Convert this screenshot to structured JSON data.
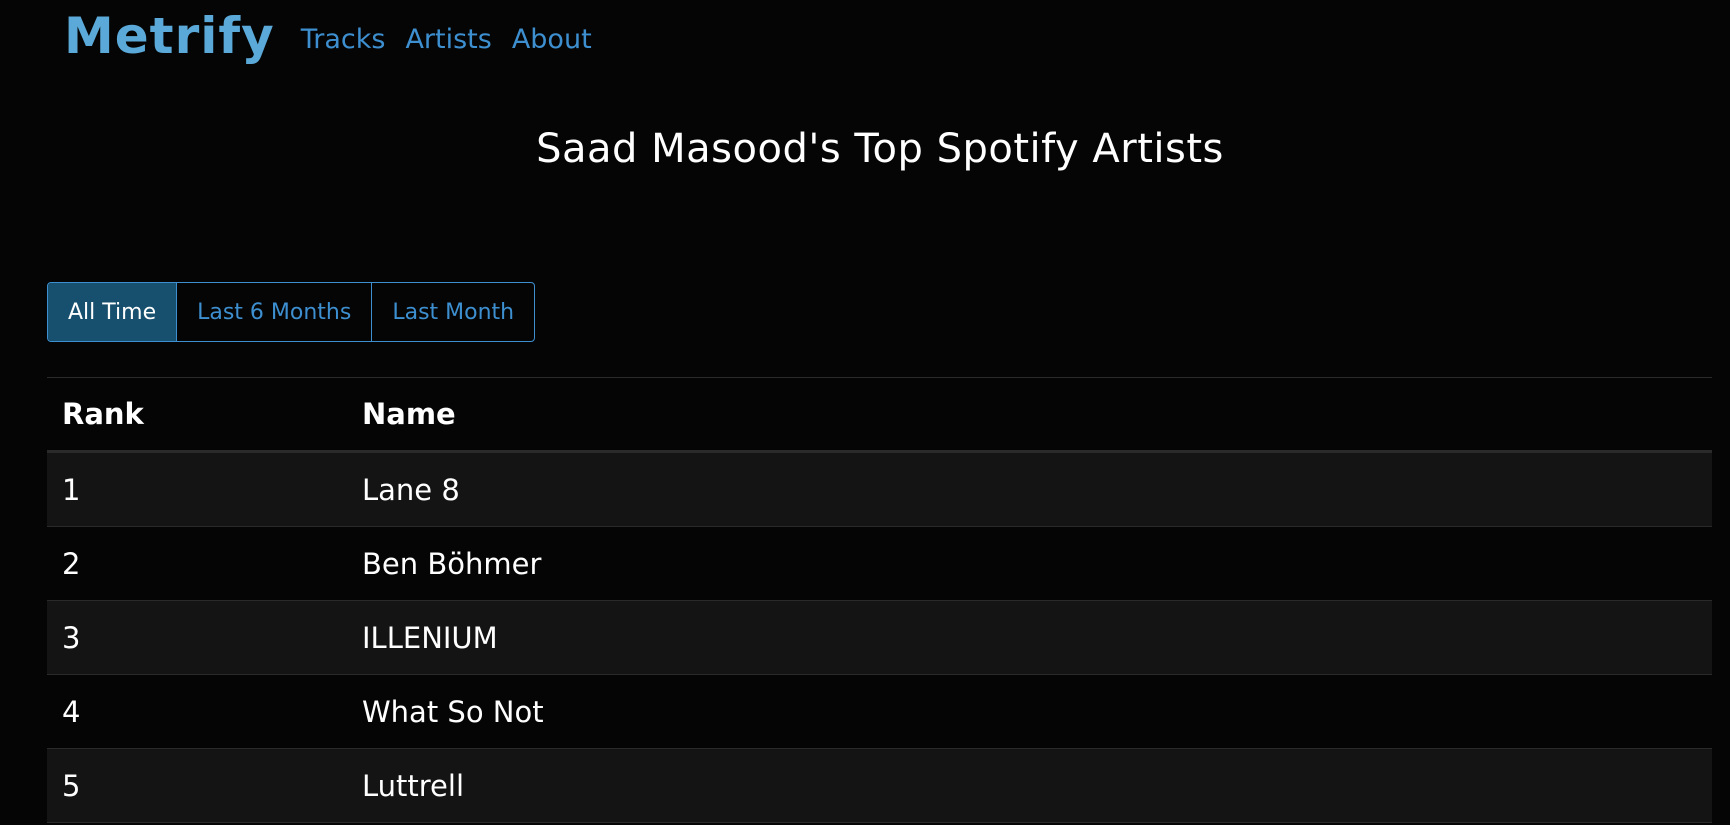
{
  "nav": {
    "brand": "Metrify",
    "links": [
      "Tracks",
      "Artists",
      "About"
    ]
  },
  "page": {
    "title": "Saad Masood's Top Spotify Artists"
  },
  "filters": {
    "options": [
      "All Time",
      "Last 6 Months",
      "Last Month"
    ],
    "selected": "All Time"
  },
  "table": {
    "headers": [
      "Rank",
      "Name"
    ],
    "rows": [
      {
        "rank": "1",
        "name": "Lane 8"
      },
      {
        "rank": "2",
        "name": "Ben Böhmer"
      },
      {
        "rank": "3",
        "name": "ILLENIUM"
      },
      {
        "rank": "4",
        "name": "What So Not"
      },
      {
        "rank": "5",
        "name": "Luttrell"
      }
    ]
  },
  "colors": {
    "background": "#050505",
    "accent": "#3d8fd0",
    "brand": "#5aa9d8",
    "active_button": "#17506e"
  }
}
